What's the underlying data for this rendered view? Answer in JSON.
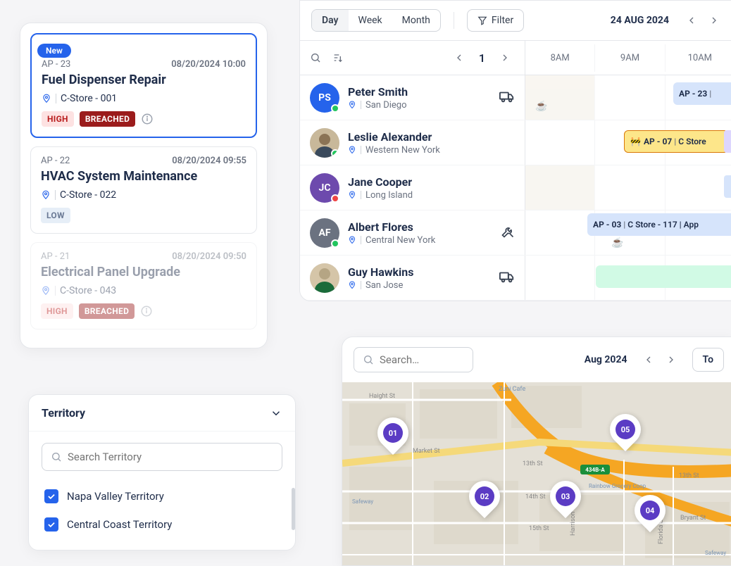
{
  "workOrders": [
    {
      "new": "New",
      "id": "AP - 23",
      "date": "08/20/2024 10:00",
      "title": "Fuel Dispenser Repair",
      "location": "C-Store - 001",
      "priority": "HIGH",
      "breached": "BREACHED"
    },
    {
      "id": "AP - 22",
      "date": "08/20/2024 09:55",
      "title": "HVAC System Maintenance",
      "location": "C-Store - 022",
      "priority": "LOW"
    },
    {
      "id": "AP - 21",
      "date": "08/20/2024 09:50",
      "title": "Electrical Panel Upgrade",
      "location": "C-Store - 043",
      "priority": "HIGH",
      "breached": "BREACHED"
    }
  ],
  "territory": {
    "title": "Territory",
    "searchPlaceholder": "Search Territory",
    "items": [
      {
        "label": "Napa Valley Territory"
      },
      {
        "label": "Central Coast Territory"
      }
    ]
  },
  "scheduler": {
    "views": {
      "day": "Day",
      "week": "Week",
      "month": "Month"
    },
    "filterLabel": "Filter",
    "date": "24 AUG 2024",
    "page": "1",
    "timeHeaders": [
      "8AM",
      "9AM",
      "10AM"
    ],
    "people": [
      {
        "initials": "PS",
        "name": "Peter Smith",
        "location": "San Diego",
        "avatarColor": "#2563eb",
        "status": "green",
        "icon": "truck"
      },
      {
        "name": "Leslie Alexander",
        "location": "Western New York",
        "status": "green"
      },
      {
        "initials": "JC",
        "name": "Jane Cooper",
        "location": "Long Island",
        "avatarColor": "#6d4aad",
        "status": "red"
      },
      {
        "initials": "AF",
        "name": "Albert Flores",
        "location": "Central New York",
        "avatarColor": "#6b7280",
        "status": "green",
        "icon": "tools"
      },
      {
        "name": "Guy Hawkins",
        "location": "San Jose",
        "icon": "truck"
      }
    ],
    "bars": {
      "row0": {
        "id": "AP - 23",
        "rest": ""
      },
      "row1": {
        "id": "AP - 07",
        "rest": "C Store"
      },
      "row3": {
        "id": "AP - 03",
        "rest": "C Store - 117 | App"
      }
    }
  },
  "map": {
    "searchPlaceholder": "Search…",
    "date": "Aug 2024",
    "today": "To",
    "pins": [
      "01",
      "02",
      "03",
      "04",
      "05"
    ],
    "streets": {
      "haight": "Haight St",
      "market": "Market St",
      "s14": "14th St",
      "s15": "15th St",
      "s13w": "13th St",
      "s13e": "13th St",
      "harrison": "Harrison St",
      "bryant": "Bryant St",
      "florida": "Florida St",
      "zuni": "Zuni Cafe",
      "grocery": "Rainbow Grocery Coop",
      "safeway1": "Safeway",
      "safeway2": "Safeway",
      "hwy": "434B-A"
    }
  }
}
